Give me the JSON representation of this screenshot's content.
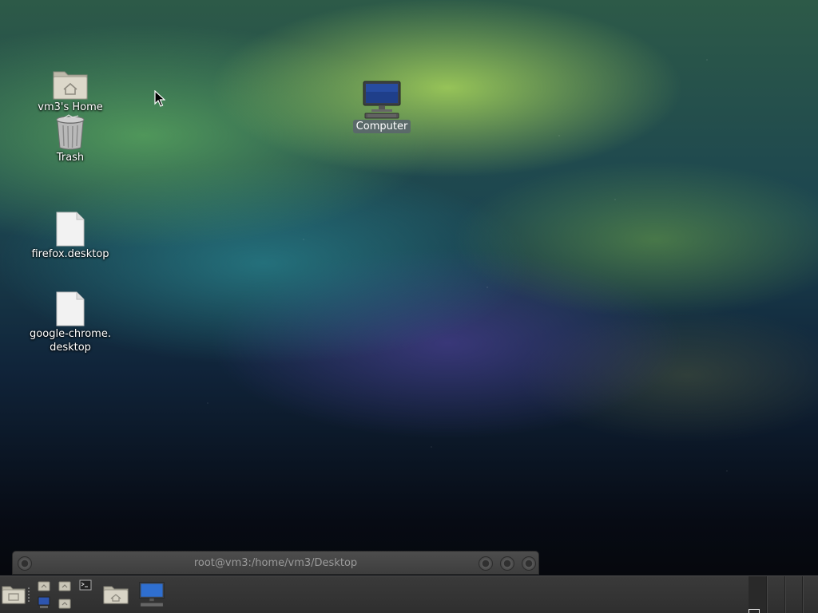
{
  "desktop": {
    "icons": [
      {
        "label": "vm3's Home",
        "icon": "home-folder-icon"
      },
      {
        "label": "Trash",
        "icon": "trash-icon"
      },
      {
        "label": "firefox.desktop",
        "icon": "document-icon"
      },
      {
        "label": "google-chrome.\ndesktop",
        "icon": "document-icon"
      },
      {
        "label": "Computer",
        "icon": "computer-icon",
        "selected": true
      }
    ]
  },
  "terminal_window": {
    "title": "root@vm3:/home/vm3/Desktop"
  },
  "taskbar": {
    "launchers": [
      "drive-icon",
      "home-folder-icon",
      "home-folder-icon",
      "terminal-icon",
      "computer-icon",
      "home-folder-icon"
    ],
    "tasks": [
      "home-folder-icon",
      "computer-icon"
    ]
  },
  "colors": {
    "panel": "#333333",
    "selection": "#5a646e",
    "folder": "#d8d4c6"
  }
}
